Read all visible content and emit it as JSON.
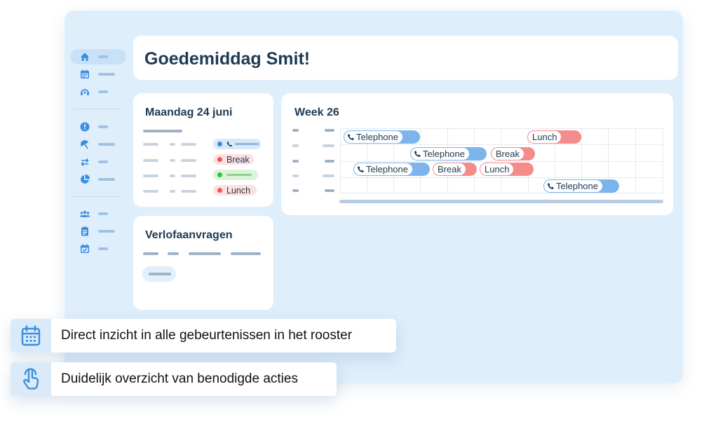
{
  "greeting": "Goedemiddag Smit!",
  "day_card": {
    "title": "Maandag 24 juni",
    "rows": [
      {
        "pill_color": "#3b8de0",
        "pill_bg": "#d6e8fa",
        "label": "",
        "has_phone": true
      },
      {
        "pill_color": "#f05656",
        "pill_bg": "#fde0e0",
        "label": "Break",
        "has_phone": false
      },
      {
        "pill_color": "#2ec52e",
        "pill_bg": "#dbf3db",
        "label": "",
        "has_phone": false
      },
      {
        "pill_color": "#f05656",
        "pill_bg": "#fde0e0",
        "label": "Lunch",
        "has_phone": false
      }
    ]
  },
  "week_card": {
    "title": "Week 26",
    "events": [
      {
        "label": "Telephone",
        "type": "blue",
        "row": 1,
        "phone": true
      },
      {
        "label": "Lunch",
        "type": "red",
        "row": 1,
        "phone": false
      },
      {
        "label": "Telephone",
        "type": "blue",
        "row": 2,
        "phone": true
      },
      {
        "label": "Break",
        "type": "red",
        "row": 2,
        "phone": false
      },
      {
        "label": "Telephone",
        "type": "blue",
        "row": 3,
        "phone": true
      },
      {
        "label": "Break",
        "type": "red",
        "row": 3,
        "phone": false
      },
      {
        "label": "Lunch",
        "type": "red",
        "row": 3,
        "phone": false
      },
      {
        "label": "Telephone",
        "type": "blue",
        "row": 4,
        "phone": true
      }
    ]
  },
  "leave_card": {
    "title": "Verlofaanvragen"
  },
  "sidebar": {
    "icons": [
      "home-icon",
      "calendar-icon",
      "support-icon",
      "alert-icon",
      "umbrella-icon",
      "swap-icon",
      "pie-chart-icon",
      "team-icon",
      "clipboard-icon",
      "calendar-check-icon"
    ]
  },
  "callouts": [
    {
      "text": "Direct inzicht in alle gebeurtenissen in het rooster",
      "icon": "calendar-icon"
    },
    {
      "text": "Duidelijk overzicht van benodigde acties",
      "icon": "tap-icon"
    }
  ],
  "colors": {
    "accent_blue": "#3b8de0",
    "event_blue": "#7db4ec",
    "event_red": "#f58b8b",
    "frame_bg": "#dfeefb",
    "heading": "#1e3a52"
  }
}
